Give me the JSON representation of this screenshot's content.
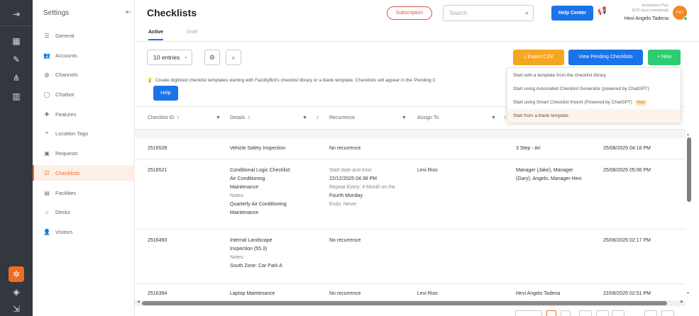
{
  "sidebar": {
    "title": "Settings",
    "items": [
      {
        "label": "General"
      },
      {
        "label": "Accounts"
      },
      {
        "label": "Channels"
      },
      {
        "label": "Chatbot"
      },
      {
        "label": "Features"
      },
      {
        "label": "Location Tags"
      },
      {
        "label": "Requests"
      },
      {
        "label": "Checklists",
        "active": true
      },
      {
        "label": "Facilities"
      },
      {
        "label": "Desks"
      },
      {
        "label": "Visitors"
      }
    ]
  },
  "header": {
    "title": "Checklists",
    "subscription_label": "Subscription",
    "search_placeholder": "Search",
    "help_center_label": "Help Center",
    "plan_name": "Enterprise Plus",
    "plan_days": "(670 days remaining)",
    "user_name": "Hevi Angelo Tadena",
    "avatar_initials": "HAT"
  },
  "tabs": [
    {
      "label": "Active",
      "active": true
    },
    {
      "label": "Draft",
      "active": false
    }
  ],
  "toolbar": {
    "entries_label": "10 entries",
    "export_label": "Export CSV",
    "pending_label": "View Pending Checklists",
    "new_label": "New"
  },
  "info": {
    "text": "Create digitized checklist templates starting with FacilityBot's checklist library or a blank template. Checklists will appear in the 'Pending C",
    "help_label": "Help"
  },
  "new_menu": {
    "items": [
      "Start with a template from the checklist library",
      "Start using Automated Checklist Generator (powered by ChatGPT)",
      "Start using Smart Checklist Import (Powered by ChatGPT)",
      "Start from a blank template"
    ],
    "beta_label": "Beta"
  },
  "table": {
    "columns": [
      "Checklist ID",
      "Details",
      "Recurrence",
      "Assign To"
    ],
    "rows": [
      {
        "id": "2516528",
        "details": [
          "Vehicle Safety Inspection"
        ],
        "recurrence": [
          "No recurrence"
        ],
        "assign_to": "",
        "assignee": [
          "3 Step - Ari"
        ],
        "updated": "25/08/2025 04:16 PM"
      },
      {
        "id": "2516521",
        "details": [
          "Conditional Logic Checklist:",
          "Air Conditioning",
          "Maintenance",
          "Notes:",
          "Quarterly Air Conditioning",
          "Maintenance"
        ],
        "recurrence": [
          "Start date and time:",
          "22/12/2025 04:38 PM",
          "Repeat Every: 4 Month on the",
          "Fourth Monday",
          "Ends: Never"
        ],
        "assign_to": "Levi Rios",
        "assignee": [
          "Manager (Jake), Manager",
          "(Gary), Angelo, Manager Hevi"
        ],
        "updated": "25/08/2025 05:06 PM"
      },
      {
        "id": "2516493",
        "details": [
          "Internal Landscape",
          "Inspection (55.3)",
          "Notes:",
          "South Zone: Car Park A"
        ],
        "recurrence": [
          "No recurrence"
        ],
        "assign_to": "",
        "assignee": [],
        "updated": "25/08/2025 02:17 PM"
      },
      {
        "id": "2516394",
        "details": [
          "Laptop Maintenance"
        ],
        "recurrence": [
          "No recurrence"
        ],
        "assign_to": "Levi Rios",
        "assignee": [
          "Hevi Angelo Tadena"
        ],
        "updated": "22/08/2025 02:51 PM"
      }
    ]
  }
}
